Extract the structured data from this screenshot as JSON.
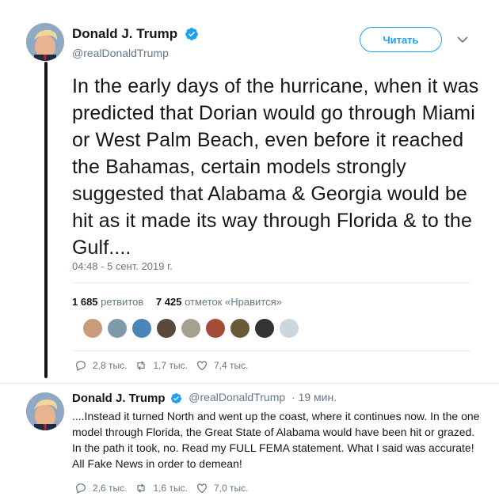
{
  "tweet": {
    "author": {
      "name": "Donald J. Trump",
      "handle": "@realDonaldTrump"
    },
    "follow_label": "Читать",
    "text": "In the early days of the hurricane, when it was predicted that Dorian would go through Miami or West Palm Beach, even before it reached the Bahamas, certain models strongly suggested that Alabama & Georgia would be hit as it made its way through Florida & to the Gulf....",
    "timestamp": "04:48 - 5 сент. 2019 г.",
    "stats": {
      "retweets_count": "1 685",
      "retweets_label": "ретвитов",
      "likes_count": "7 425",
      "likes_label": "отметок «Нравится»"
    },
    "actions": {
      "replies": "2,8 тыс.",
      "retweets": "1,7 тыс.",
      "likes": "7,4 тыс."
    }
  },
  "reply": {
    "author": {
      "name": "Donald J. Trump",
      "handle": "@realDonaldTrump"
    },
    "time": "· 19 мин.",
    "text": "....Instead it turned North and went up the coast, where it continues now. In the one model through Florida, the Great State of Alabama would have been hit or grazed. In the path it took, no. Read my FULL FEMA statement. What I said was accurate! All Fake News in order to demean!",
    "actions": {
      "replies": "2,6 тыс.",
      "retweets": "1,6 тыс.",
      "likes": "7,0 тыс."
    }
  },
  "icons": {
    "verified": "verified-badge-icon",
    "caret": "chevron-down-icon",
    "reply": "reply-icon",
    "retweet": "retweet-icon",
    "like": "heart-icon"
  },
  "colors": {
    "accent": "#1da1f2",
    "text": "#14171a",
    "muted": "#657786",
    "divider": "#e6ecf0"
  }
}
